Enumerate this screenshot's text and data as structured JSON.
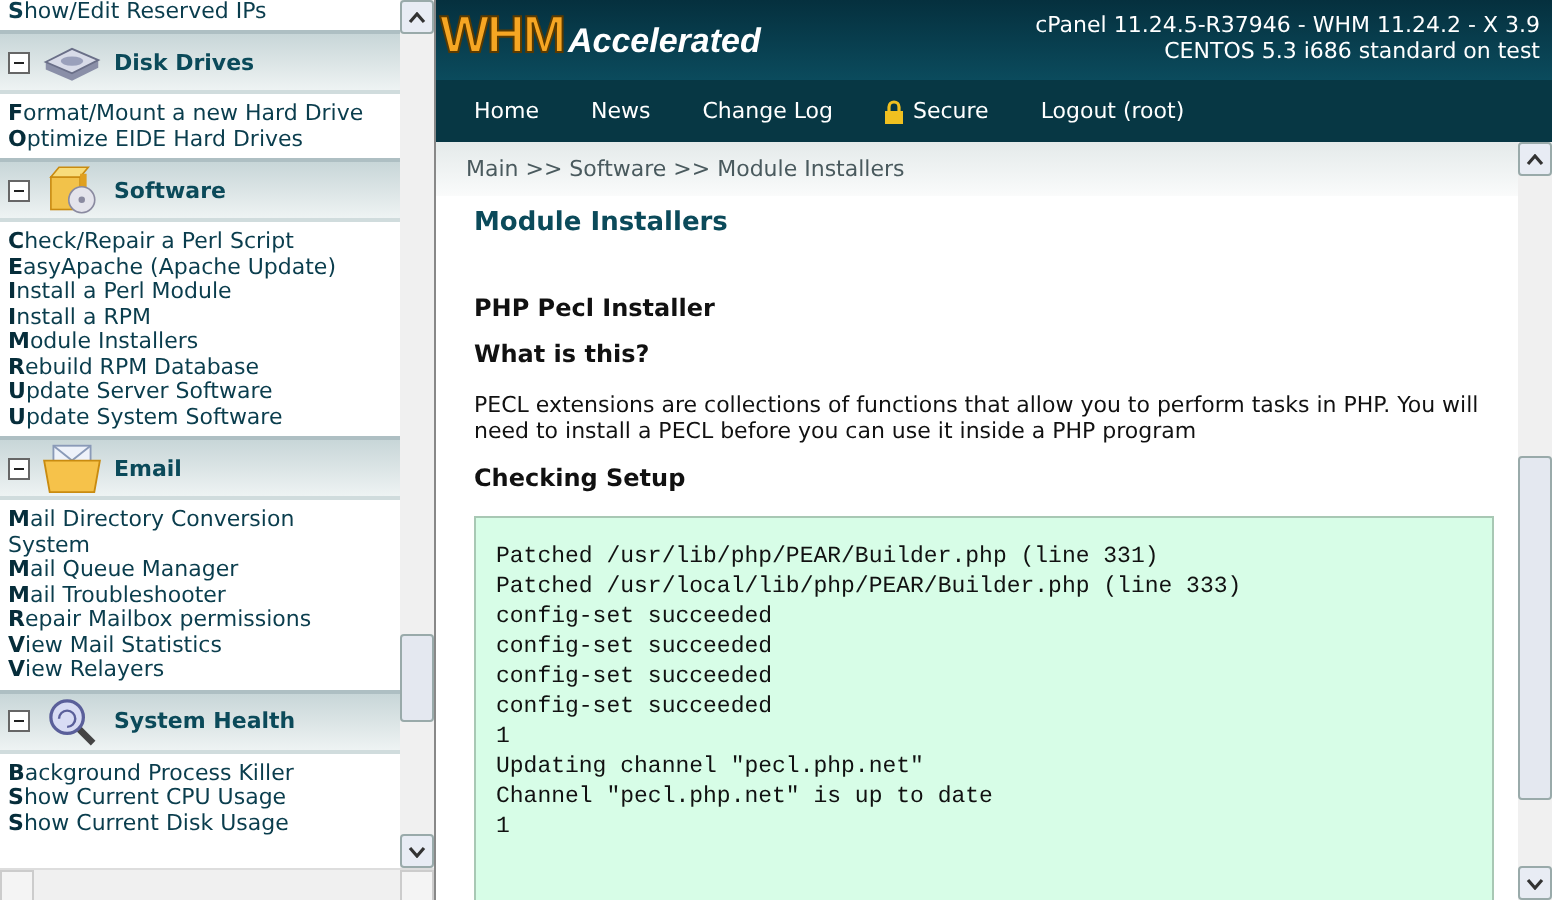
{
  "sidebar": {
    "top_item": "**S**how/Edit Reserved IPs",
    "sections": [
      {
        "title": "Disk Drives",
        "expanded": true,
        "items": [
          "**F**ormat/Mount a new Hard Drive",
          "**O**ptimize EIDE Hard Drives"
        ]
      },
      {
        "title": "Software",
        "expanded": true,
        "items": [
          "**C**heck/Repair a Perl Script",
          "**E**asyApache (Apache Update)",
          "**I**nstall a Perl Module",
          "**I**nstall a RPM",
          "**M**odule Installers",
          "**R**ebuild RPM Database",
          "**U**pdate Server Software",
          "**U**pdate System Software"
        ]
      },
      {
        "title": "Email",
        "expanded": true,
        "items": [
          "**M**ail Directory Conversion System",
          "**M**ail Queue Manager",
          "**M**ail Troubleshooter",
          "**R**epair Mailbox permissions",
          "**V**iew Mail Statistics",
          "**V**iew Relayers"
        ]
      },
      {
        "title": "System Health",
        "expanded": true,
        "items": [
          "**B**ackground Process Killer",
          "**S**how Current CPU Usage",
          "**S**how Current Disk Usage"
        ]
      }
    ]
  },
  "header": {
    "logo_main": "WHM",
    "logo_sub": "Accelerated",
    "version_line": "cPanel 11.24.5-R37946 - WHM 11.24.2 - X 3.9",
    "system_line": "CENTOS 5.3 i686 standard on test"
  },
  "nav": [
    {
      "label": "Home",
      "kind": "link"
    },
    {
      "label": "News",
      "kind": "link"
    },
    {
      "label": "Change Log",
      "kind": "link"
    },
    {
      "label": "Secure",
      "kind": "secure"
    },
    {
      "label": "Logout (root)",
      "kind": "link"
    }
  ],
  "breadcrumb": "Main >> Software >> Module Installers",
  "page": {
    "title": "Module Installers",
    "section_title": "PHP Pecl Installer",
    "question": "What is this?",
    "description": "PECL extensions are collections of functions that allow you to perform tasks in PHP. You will need to install a PECL before you can use it inside a PHP program",
    "setup_title": "Checking Setup",
    "output_lines": [
      "Patched /usr/lib/php/PEAR/Builder.php (line 331)",
      "Patched /usr/local/lib/php/PEAR/Builder.php (line 333)",
      "config-set succeeded",
      "config-set succeeded",
      "config-set succeeded",
      "config-set succeeded",
      "1",
      "Updating channel \"pecl.php.net\"",
      "Channel \"pecl.php.net\" is up to date",
      "1"
    ]
  }
}
